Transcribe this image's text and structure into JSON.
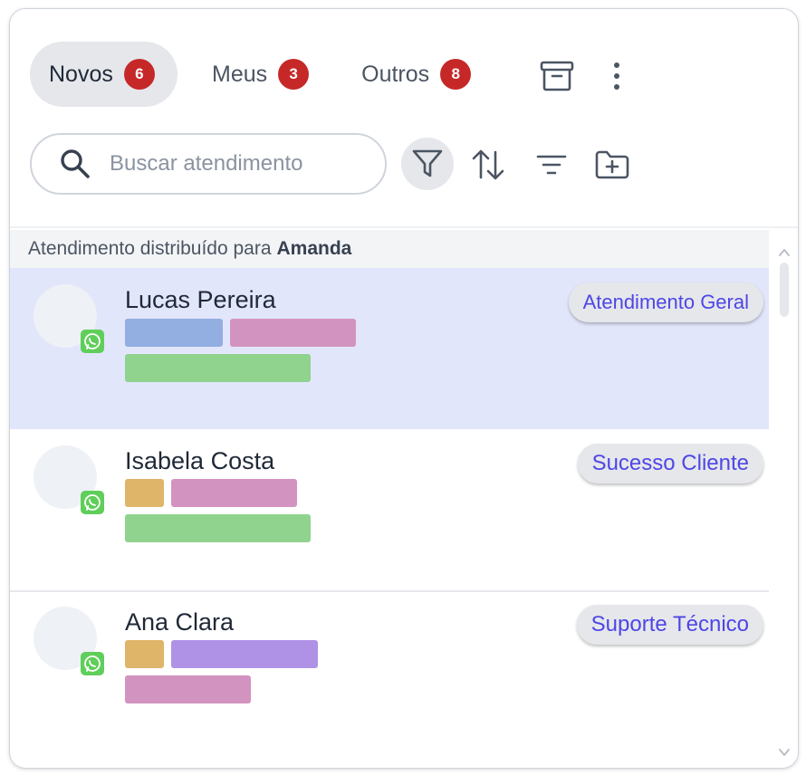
{
  "tabs": [
    {
      "label": "Novos",
      "count": "6"
    },
    {
      "label": "Meus",
      "count": "3"
    },
    {
      "label": "Outros",
      "count": "8"
    }
  ],
  "search": {
    "placeholder": "Buscar atendimento",
    "value": ""
  },
  "list": {
    "group_prefix": "Atendimento distribuído para",
    "group_agent": "Amanda",
    "items": [
      {
        "name": "Lucas Pereira",
        "department": "Atendimento Geral",
        "channel_icon": "whatsapp-icon"
      },
      {
        "name": "Isabela Costa",
        "department": "Sucesso Cliente",
        "channel_icon": "whatsapp-icon"
      },
      {
        "name": "Ana Clara",
        "department": "Suporte Técnico",
        "channel_icon": "whatsapp-icon"
      }
    ]
  },
  "colors": {
    "accent": "#4f46e5",
    "badge": "#c62828",
    "selected_row": "#e2e6fb",
    "tag_blue": "#93aee0",
    "tag_pink": "#d393c0",
    "tag_green": "#8fd38e",
    "tag_orange": "#dfb56a",
    "tag_purple": "#af92e6"
  },
  "icons": [
    "archive-icon",
    "more-vertical-icon",
    "search-icon",
    "filter-icon",
    "sort-icon",
    "filter-lines-icon",
    "folder-plus-icon",
    "whatsapp-icon",
    "chevron-up-icon",
    "chevron-down-icon"
  ]
}
